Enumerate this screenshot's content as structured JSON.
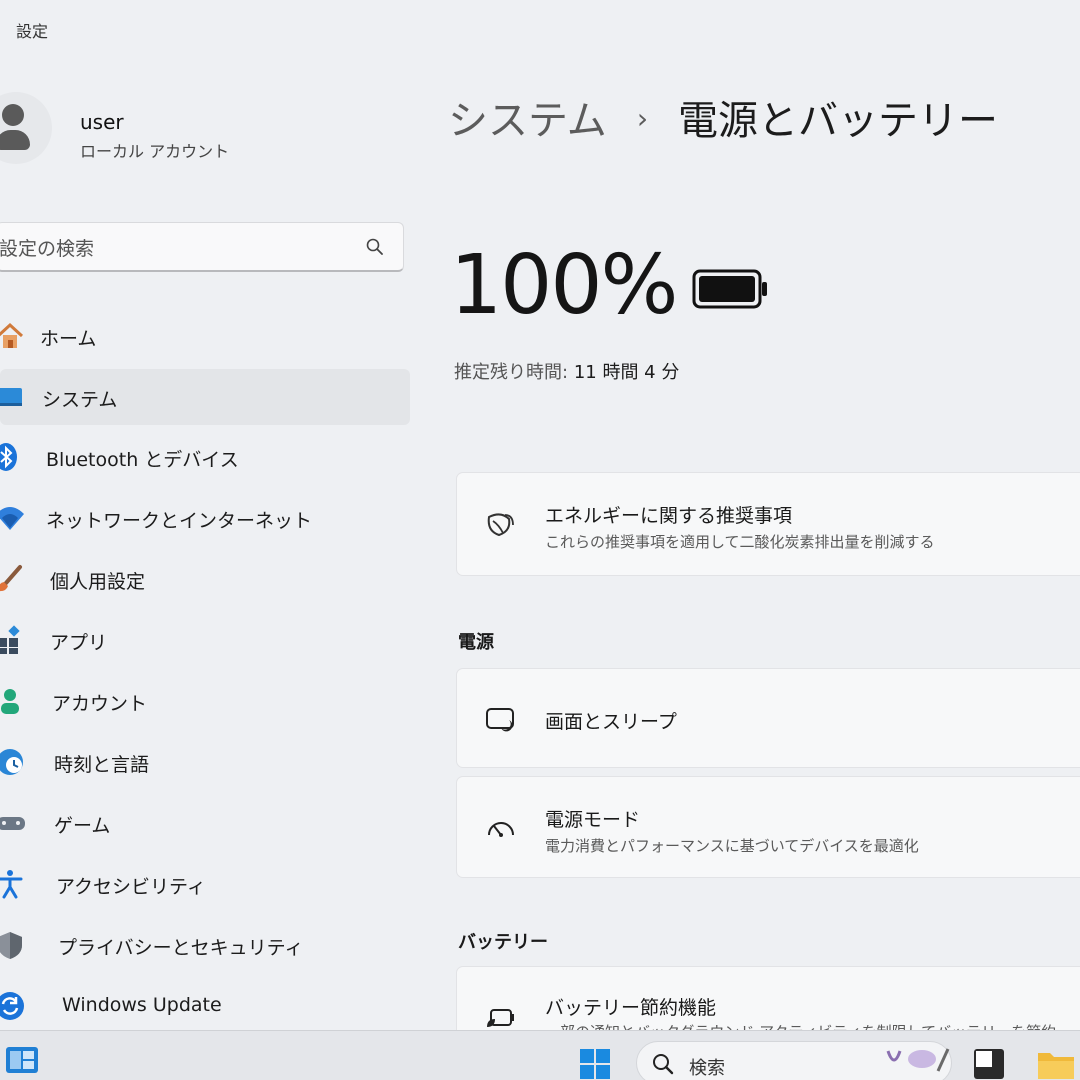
{
  "window": {
    "title": "設定"
  },
  "profile": {
    "name": "user",
    "account_type": "ローカル アカウント"
  },
  "search": {
    "placeholder": "設定の検索"
  },
  "sidebar": {
    "items": [
      {
        "label": "ホーム",
        "icon": "home-icon"
      },
      {
        "label": "システム",
        "icon": "monitor-icon",
        "active": true
      },
      {
        "label": "Bluetooth とデバイス",
        "icon": "bluetooth-icon"
      },
      {
        "label": "ネットワークとインターネット",
        "icon": "wifi-icon"
      },
      {
        "label": "個人用設定",
        "icon": "brush-icon"
      },
      {
        "label": "アプリ",
        "icon": "apps-icon"
      },
      {
        "label": "アカウント",
        "icon": "person-icon"
      },
      {
        "label": "時刻と言語",
        "icon": "globe-clock-icon"
      },
      {
        "label": "ゲーム",
        "icon": "gamepad-icon"
      },
      {
        "label": "アクセシビリティ",
        "icon": "accessibility-icon"
      },
      {
        "label": "プライバシーとセキュリティ",
        "icon": "shield-icon"
      },
      {
        "label": "Windows Update",
        "icon": "update-icon"
      }
    ]
  },
  "breadcrumb": {
    "parent": "システム",
    "separator": "›",
    "current": "電源とバッテリー"
  },
  "battery": {
    "percent_text": "100%",
    "level": 100,
    "estimate_label": "推定残り時間:",
    "estimate_value": "11 時間 4 分"
  },
  "energy_card": {
    "title": "エネルギーに関する推奨事項",
    "subtitle": "これらの推奨事項を適用して二酸化炭素排出量を削減する",
    "icon": "leaf-icon"
  },
  "power_section": {
    "heading": "電源",
    "screen_sleep": {
      "title": "画面とスリープ",
      "icon": "screen-sleep-icon"
    },
    "power_mode": {
      "title": "電源モード",
      "subtitle": "電力消費とパフォーマンスに基づいてデバイスを最適化",
      "icon": "gauge-icon"
    }
  },
  "battery_section": {
    "heading": "バッテリー",
    "saver": {
      "title": "バッテリー節約機能",
      "subtitle": "一部の通知とバックグラウンド アクティビティを制限してバッテリーを節約",
      "icon": "battery-saver-icon"
    }
  },
  "taskbar": {
    "search_label": "検索"
  },
  "colors": {
    "accent": "#0067c0",
    "background": "#eef0f3",
    "card": "#f7f8f9"
  }
}
